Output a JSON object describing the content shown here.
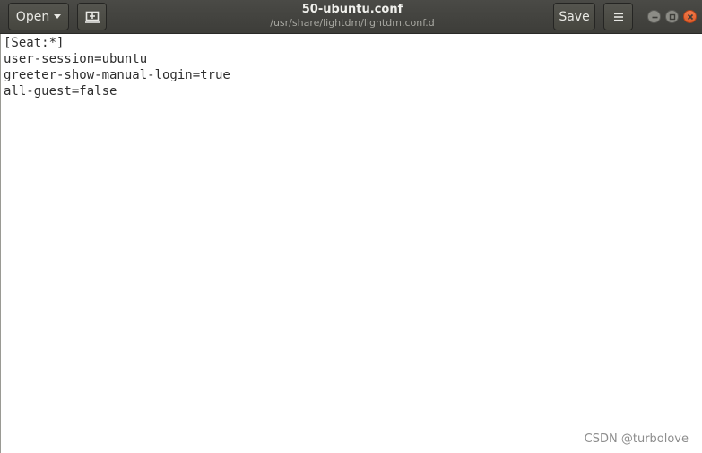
{
  "header": {
    "open_label": "Open",
    "title": "50-ubuntu.conf",
    "subtitle": "/usr/share/lightdm/lightdm.conf.d",
    "save_label": "Save"
  },
  "editor": {
    "lines": [
      "[Seat:*]",
      "user-session=ubuntu",
      "greeter-show-manual-login=true",
      "all-guest=false"
    ]
  },
  "watermark": "CSDN @turbolove",
  "icons": {
    "open_caret": "chevron-down-icon",
    "new_tab": "new-tab-icon",
    "menu": "hamburger-menu-icon",
    "minimize": "minimize-icon",
    "maximize": "maximize-icon",
    "close": "close-icon"
  },
  "colors": {
    "headerbar": "#3d3d39",
    "close_button": "#e05d2a",
    "editor_background": "#ffffff"
  }
}
